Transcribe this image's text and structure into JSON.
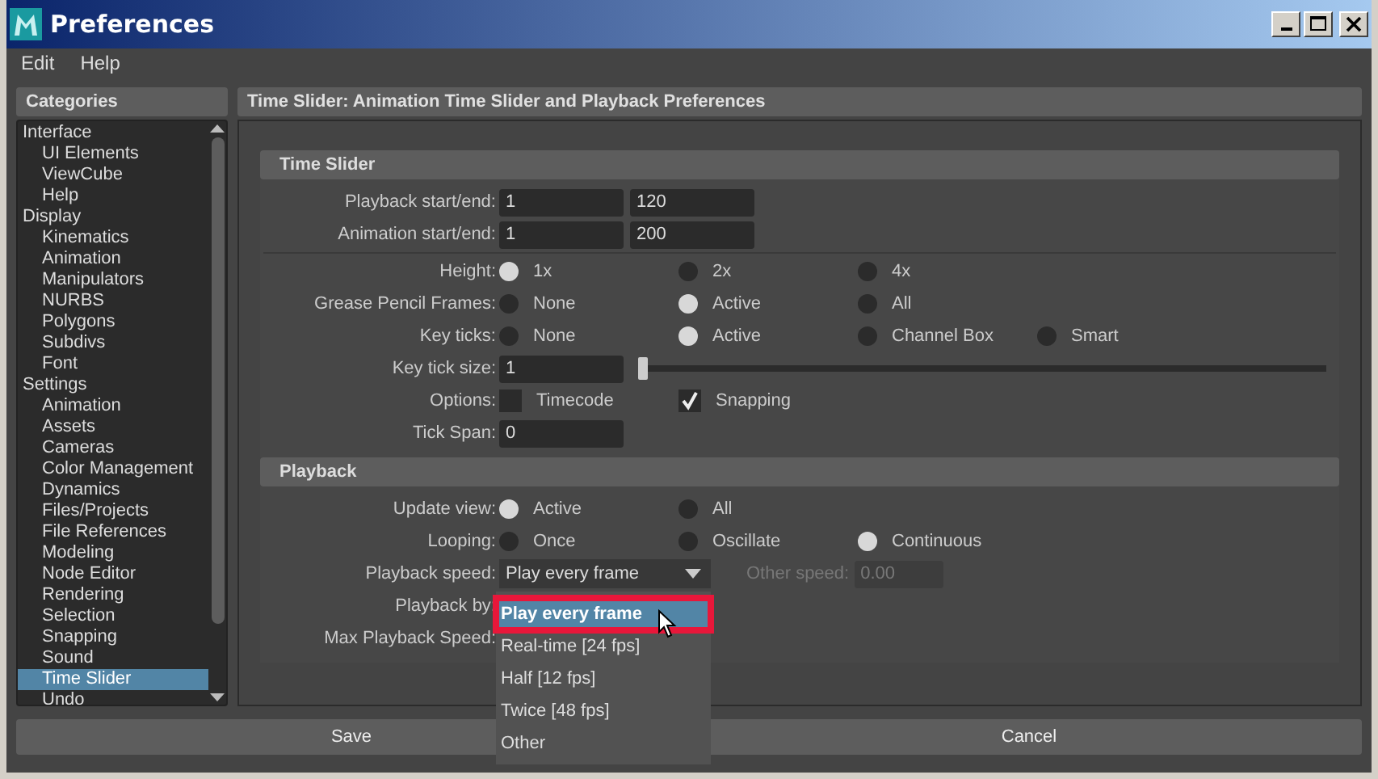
{
  "window": {
    "title": "Preferences"
  },
  "menu": [
    "Edit",
    "Help"
  ],
  "categories": {
    "title": "Categories",
    "items": [
      {
        "label": "Interface",
        "selected": false,
        "children": [
          {
            "label": "UI Elements",
            "selected": false
          },
          {
            "label": "ViewCube",
            "selected": false
          },
          {
            "label": "Help",
            "selected": false
          }
        ]
      },
      {
        "label": "Display",
        "selected": false,
        "children": [
          {
            "label": "Kinematics",
            "selected": false
          },
          {
            "label": "Animation",
            "selected": false
          },
          {
            "label": "Manipulators",
            "selected": false
          },
          {
            "label": "NURBS",
            "selected": false
          },
          {
            "label": "Polygons",
            "selected": false
          },
          {
            "label": "Subdivs",
            "selected": false
          },
          {
            "label": "Font",
            "selected": false
          }
        ]
      },
      {
        "label": "Settings",
        "selected": false,
        "children": [
          {
            "label": "Animation",
            "selected": false
          },
          {
            "label": "Assets",
            "selected": false
          },
          {
            "label": "Cameras",
            "selected": false
          },
          {
            "label": "Color Management",
            "selected": false
          },
          {
            "label": "Dynamics",
            "selected": false
          },
          {
            "label": "Files/Projects",
            "selected": false
          },
          {
            "label": "File References",
            "selected": false
          },
          {
            "label": "Modeling",
            "selected": false
          },
          {
            "label": "Node Editor",
            "selected": false
          },
          {
            "label": "Rendering",
            "selected": false
          },
          {
            "label": "Selection",
            "selected": false
          },
          {
            "label": "Snapping",
            "selected": false
          },
          {
            "label": "Sound",
            "selected": false
          },
          {
            "label": "Time Slider",
            "selected": true
          },
          {
            "label": "Undo",
            "selected": false
          }
        ]
      }
    ]
  },
  "panel": {
    "title": "Time Slider: Animation Time Slider and Playback Preferences",
    "sections": [
      {
        "title": "Time Slider",
        "rows": [
          {
            "kind": "pair",
            "label": "Playback start/end:",
            "values": [
              "1",
              "120"
            ]
          },
          {
            "kind": "pair",
            "label": "Animation start/end:",
            "values": [
              "1",
              "200"
            ]
          },
          {
            "kind": "separator"
          },
          {
            "kind": "radio",
            "label": "Height:",
            "options": [
              {
                "label": "1x",
                "selected": true
              },
              {
                "label": "2x",
                "selected": false
              },
              {
                "label": "4x",
                "selected": false
              }
            ]
          },
          {
            "kind": "radio",
            "label": "Grease Pencil Frames:",
            "options": [
              {
                "label": "None",
                "selected": false
              },
              {
                "label": "Active",
                "selected": true
              },
              {
                "label": "All",
                "selected": false
              }
            ]
          },
          {
            "kind": "radio",
            "label": "Key ticks:",
            "options": [
              {
                "label": "None",
                "selected": false
              },
              {
                "label": "Active",
                "selected": true
              },
              {
                "label": "Channel Box",
                "selected": false
              },
              {
                "label": "Smart",
                "selected": false
              }
            ]
          },
          {
            "kind": "slider",
            "label": "Key tick size:",
            "value": "1",
            "level": 0
          },
          {
            "kind": "checks",
            "label": "Options:",
            "options": [
              {
                "label": "Timecode",
                "checked": false
              },
              {
                "label": "Snapping",
                "checked": true
              }
            ]
          },
          {
            "kind": "field",
            "label": "Tick Span:",
            "value": "0"
          }
        ]
      },
      {
        "title": "Playback",
        "rows": [
          {
            "kind": "radio",
            "label": "Update view:",
            "options": [
              {
                "label": "Active",
                "selected": true
              },
              {
                "label": "All",
                "selected": false
              }
            ]
          },
          {
            "kind": "radio",
            "label": "Looping:",
            "options": [
              {
                "label": "Once",
                "selected": false
              },
              {
                "label": "Oscillate",
                "selected": false
              },
              {
                "label": "Continuous",
                "selected": true
              }
            ]
          },
          {
            "kind": "combo",
            "label": "Playback speed:",
            "value": "Play every frame",
            "other_label": "Other speed:",
            "other_value": "0.00",
            "other_disabled": true
          },
          {
            "kind": "label",
            "label": "Playback by:"
          },
          {
            "kind": "label",
            "label": "Max Playback Speed:"
          }
        ]
      }
    ]
  },
  "dropdown": {
    "options": [
      {
        "label": "Play every frame",
        "selected": true
      },
      {
        "label": "Real-time [24 fps]",
        "selected": false
      },
      {
        "label": "Half [12 fps]",
        "selected": false
      },
      {
        "label": "Twice [48 fps]",
        "selected": false
      },
      {
        "label": "Other",
        "selected": false
      }
    ]
  },
  "buttons": [
    "Save",
    "Cancel"
  ]
}
